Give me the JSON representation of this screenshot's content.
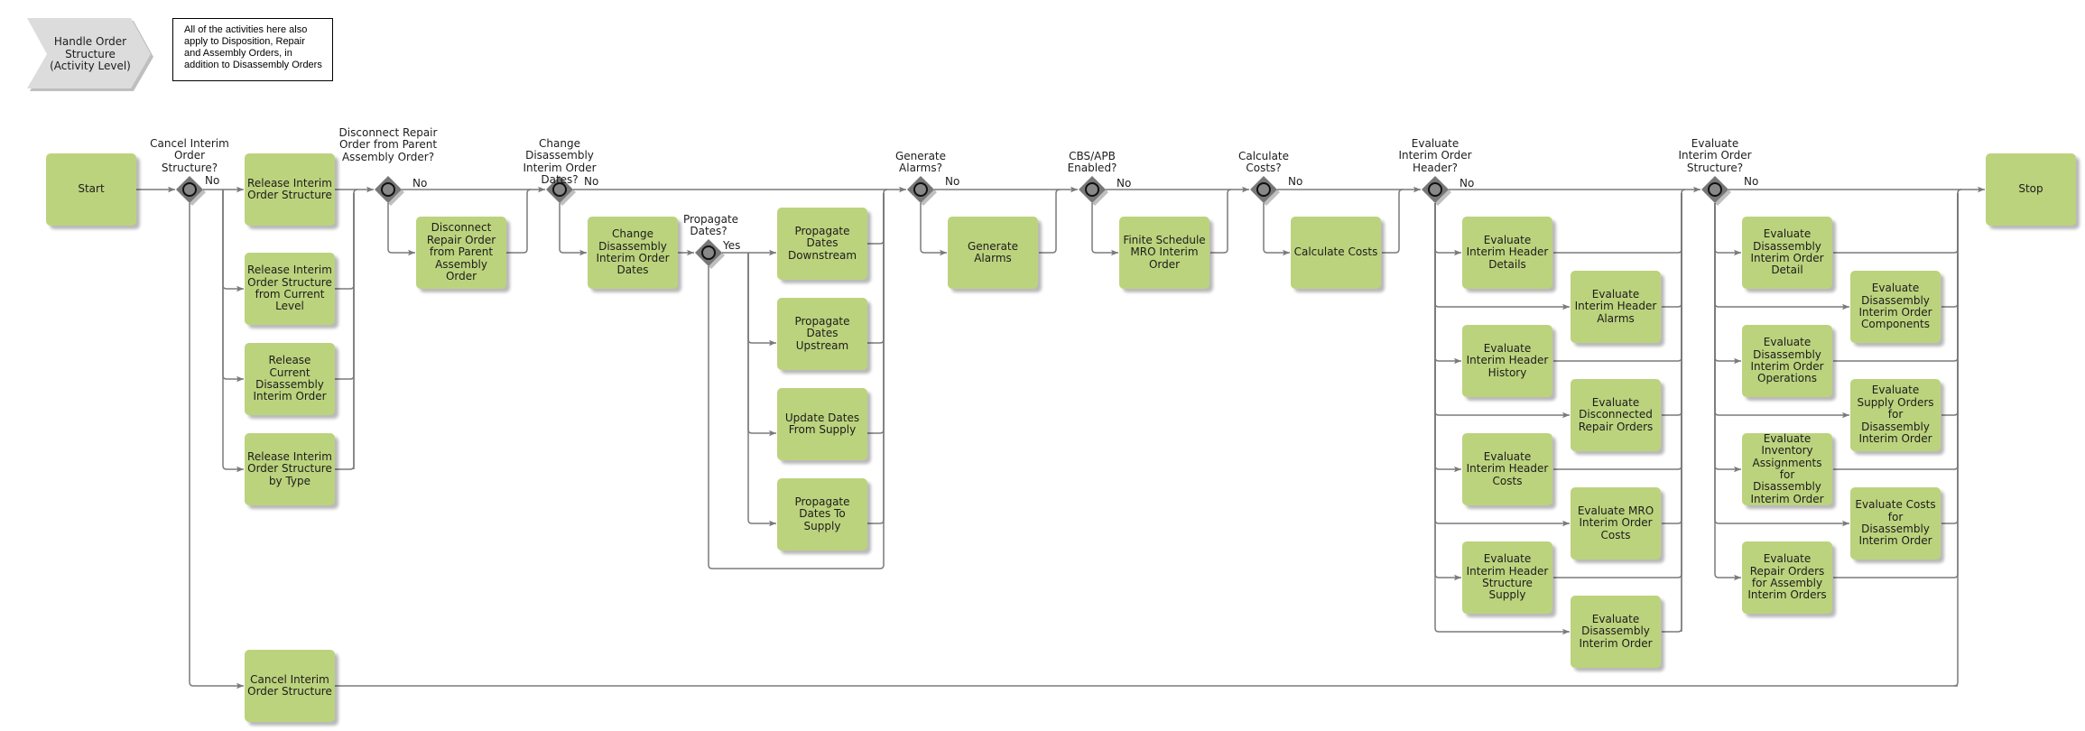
{
  "header": {
    "title": "Handle Order\nStructure\n(Activity Level)",
    "note": "All of the activities here also apply to Disposition, Repair and Assembly Orders, in addition to Disassembly Orders"
  },
  "colors": {
    "task_fill": "#bcd37d",
    "gateway_fill": "#777777",
    "gateway_circle": "#888888",
    "flow_line": "#7a7a7a",
    "header_fill": "#dcdcdc"
  },
  "events": {
    "start": "Start",
    "stop": "Stop"
  },
  "gateways": [
    {
      "id": "g_cancel",
      "label": "Cancel Interim Order Structure?",
      "outgoing_label": "No"
    },
    {
      "id": "g_disconnect",
      "label": "Disconnect Repair Order from Parent Assembly Order?",
      "outgoing_label": "No"
    },
    {
      "id": "g_change",
      "label": "Change Disassembly Interim Order Dates?",
      "outgoing_label": "No"
    },
    {
      "id": "g_propagate",
      "label": "Propagate Dates?",
      "outgoing_label": "Yes"
    },
    {
      "id": "g_alarms",
      "label": "Generate Alarms?",
      "outgoing_label": "No"
    },
    {
      "id": "g_cbs",
      "label": "CBS/APB Enabled?",
      "outgoing_label": "No"
    },
    {
      "id": "g_costs",
      "label": "Calculate Costs?",
      "outgoing_label": "No"
    },
    {
      "id": "g_header",
      "label": "Evaluate Interim Order Header?",
      "outgoing_label": "No"
    },
    {
      "id": "g_structure",
      "label": "Evaluate Interim Order Structure?",
      "outgoing_label": "No"
    }
  ],
  "tasks": {
    "release_ios": "Release Interim Order Structure",
    "release_ios_current_level": "Release Interim Order Structure from Current Level",
    "release_current_disassembly": "Release Current Disassembly Interim Order",
    "release_ios_by_type": "Release Interim Order Structure by Type",
    "cancel_ios": "Cancel Interim Order Structure",
    "disconnect_repair": "Disconnect Repair Order from Parent Assembly Order",
    "change_dates": "Change Disassembly Interim Order Dates",
    "propagate_downstream": "Propagate Dates Downstream",
    "propagate_upstream": "Propagate Dates Upstream",
    "update_from_supply": "Update Dates From Supply",
    "propagate_to_supply": "Propagate Dates To Supply",
    "generate_alarms": "Generate Alarms",
    "finite_schedule": "Finite Schedule MRO Interim Order",
    "calculate_costs": "Calculate Costs",
    "eval_header_details": "Evaluate Interim Header Details",
    "eval_header_alarms": "Evaluate Interim Header Alarms",
    "eval_header_history": "Evaluate Interim Header History",
    "eval_disconnected_repair": "Evaluate Disconnected Repair Orders",
    "eval_header_costs": "Evaluate Interim Header Costs",
    "eval_mro_costs": "Evaluate MRO Interim Order Costs",
    "eval_header_structure_supply": "Evaluate Interim Header Structure Supply",
    "eval_disassembly_io": "Evaluate Disassembly Interim Order",
    "eval_dio_detail": "Evaluate Disassembly Interim Order Detail",
    "eval_dio_components": "Evaluate Disassembly Interim Order Components",
    "eval_dio_operations": "Evaluate Disassembly Interim Order Operations",
    "eval_supply_orders": "Evaluate Supply Orders for Disassembly Interim Order",
    "eval_inventory_assignments": "Evaluate Inventory Assignments for Disassembly Interim Order",
    "eval_costs_dio": "Evaluate Costs for Disassembly Interim Order",
    "eval_repair_orders_assembly": "Evaluate Repair Orders for Assembly Interim Orders"
  }
}
